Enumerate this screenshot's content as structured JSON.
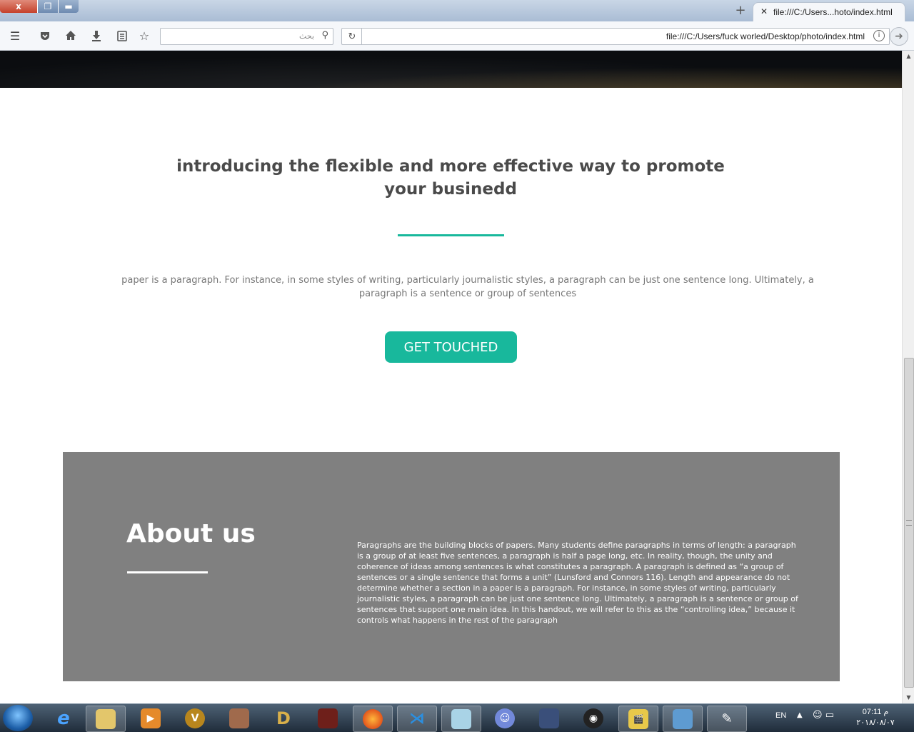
{
  "browser": {
    "tab_title": "file:///C:/Users...hoto/index.html",
    "search_placeholder": "بحث",
    "url": "file:///C:/Users/fuck worled/Desktop/photo/index.html",
    "window_close": "x"
  },
  "page": {
    "intro_title": "introducing the flexible and more effective way to promote your businedd",
    "intro_paragraph": "paper is a paragraph. For instance, in some styles of writing, particularly journalistic styles, a paragraph can be just one sentence long. Ultimately, a paragraph is a sentence or group of sentences",
    "cta_label": "GET TOUCHED",
    "about_title": "About us",
    "about_text": "Paragraphs are the building blocks of papers. Many students define paragraphs in terms of length: a paragraph is a group of at least five sentences, a paragraph is half a page long, etc. In reality, though, the unity and coherence of ideas among sentences is what constitutes a paragraph. A paragraph is defined as “a group of sentences or a single sentence that forms a unit” (Lunsford and Connors 116). Length and appearance do not determine whether a section in a paper is a paragraph. For instance, in some styles of writing, particularly journalistic styles, a paragraph can be just one sentence long. Ultimately, a paragraph is a sentence or group of sentences that support one main idea. In this handout, we will refer to this as the “controlling idea,” because it controls what happens in the rest of the paragraph"
  },
  "colors": {
    "accent": "#18b89c",
    "about_bg": "#808080"
  },
  "taskbar": {
    "language": "EN",
    "time": "07:11 م",
    "date": "٢٠١٨/٠٨/٠٧",
    "apps": [
      "internet-explorer",
      "file-explorer",
      "media-player",
      "game-shield",
      "game-character",
      "game-d",
      "game-warrior",
      "firefox",
      "visual-studio-code",
      "notepad",
      "discord",
      "game-wizard",
      "game-shield-2",
      "movie-maker",
      "photo-viewer",
      "pen-tool"
    ]
  }
}
